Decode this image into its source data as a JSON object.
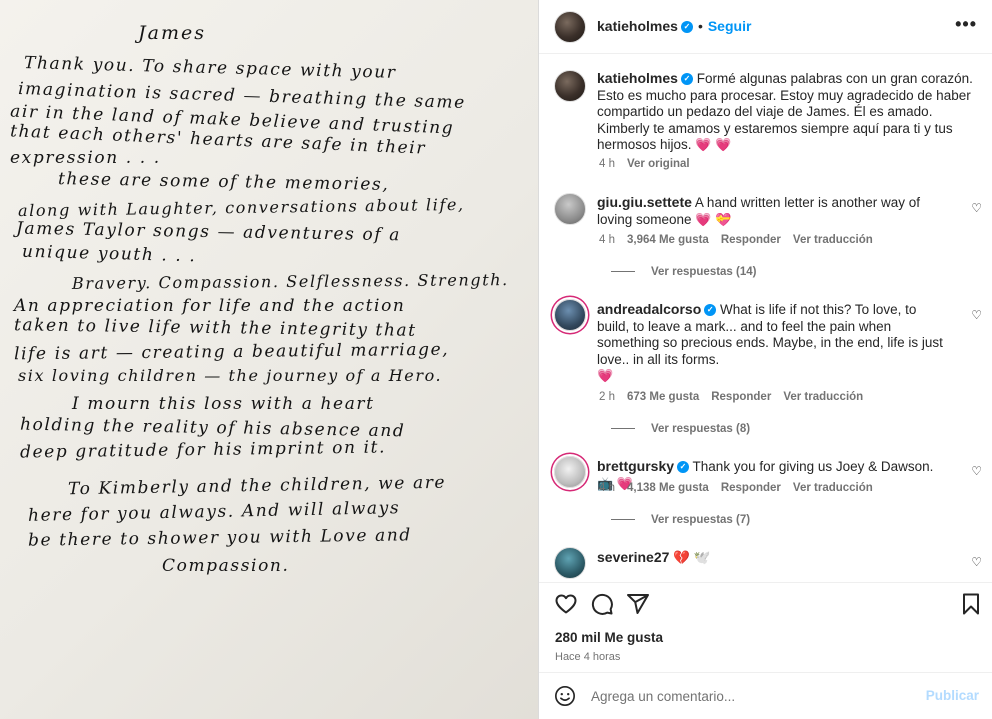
{
  "letter": {
    "lines": [
      "James",
      "Thank you.  To share space with your",
      "imagination is sacred — breathing the same",
      "air in the land of make believe and trusting",
      "that each others' hearts are safe in their",
      "expression . . .",
      "these are some of the memories,",
      "along with Laughter, conversations about life,",
      "James Taylor songs — adventures of a",
      "unique youth . . .",
      "Bravery. Compassion. Selflessness. Strength.",
      "An appreciation for life and the action",
      "taken to live life with the integrity that",
      "life is art — creating a beautiful marriage,",
      "six loving children — the journey of a Hero.",
      "I mourn this loss with a heart",
      "holding the reality of his absence and",
      "deep gratitude for his imprint on it.",
      "To Kimberly and the children, we are",
      "here for you always. And will always",
      "be there to shower you with Love and",
      "Compassion."
    ]
  },
  "header": {
    "username": "katieholmes",
    "separator": "•",
    "follow_label": "Seguir",
    "more_label": "•••"
  },
  "caption": {
    "username": "katieholmes",
    "text": "Formé algunas palabras con un gran corazón. Esto es mucho para procesar. Estoy muy agradecido de haber compartido un pedazo del viaje de James. Él es amado. Kimberly te amamos y estaremos siempre aquí para ti y tus hermosos hijos.",
    "emoji": "💗  💗",
    "time": "4 h",
    "see_original": "Ver original"
  },
  "comments": [
    {
      "username": "giu.giu.settete",
      "verified": false,
      "text": "A hand written letter is another way of loving someone",
      "emoji": "💗 💝",
      "time": "4 h",
      "likes": "3,964 Me gusta",
      "reply": "Responder",
      "translate": "Ver traducción",
      "replies": "Ver respuestas (14)"
    },
    {
      "username": "andreadalcorso",
      "verified": true,
      "text": "What is life if not this? To love, to build, to leave a mark... and to feel the pain when something so precious ends. Maybe, in the end, life is just love.. in all its forms.",
      "emoji": "💗",
      "time": "2 h",
      "likes": "673 Me gusta",
      "reply": "Responder",
      "translate": "Ver traducción",
      "replies": "Ver respuestas (8)"
    },
    {
      "username": "brettgursky",
      "verified": true,
      "text": "Thank you for giving us Joey & Dawson.",
      "emoji": "📺 💗",
      "time": "4 h",
      "likes": "4,138 Me gusta",
      "reply": "Responder",
      "translate": "Ver traducción",
      "replies": "Ver respuestas (7)"
    },
    {
      "username": "severine27",
      "verified": false,
      "text": "",
      "emoji": "💔 🕊️",
      "time": "",
      "likes": "",
      "reply": "",
      "translate": "",
      "replies": ""
    }
  ],
  "actions": {
    "likes": "280 mil Me gusta",
    "ago": "Hace 4 horas"
  },
  "composer": {
    "placeholder": "Agrega un comentario...",
    "publish_label": "Publicar"
  },
  "colors": {
    "accent": "#0095f6",
    "heart": "#e8245e",
    "muted": "#737373"
  }
}
